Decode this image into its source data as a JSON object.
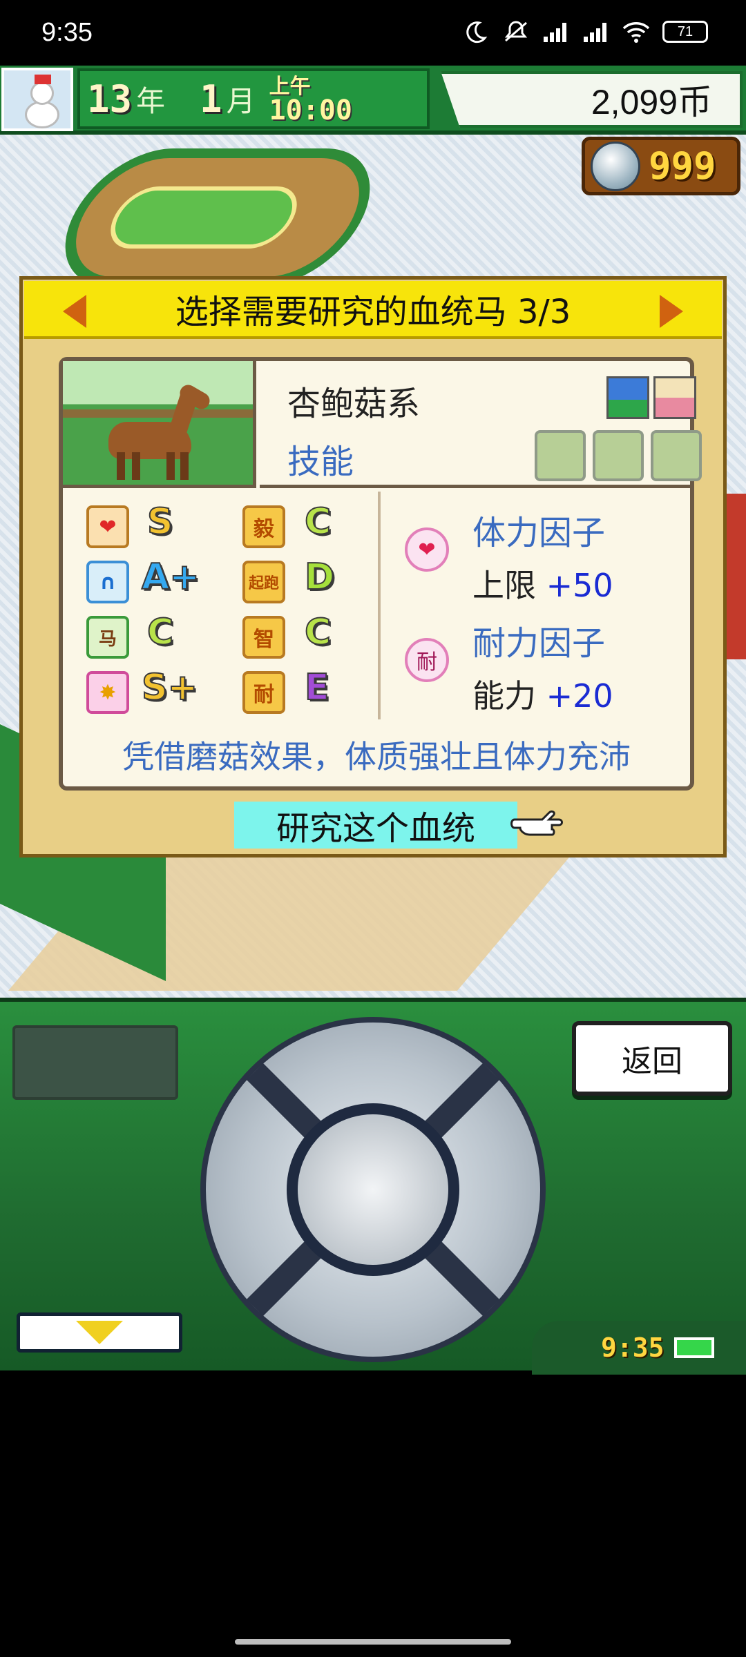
{
  "status_bar": {
    "time": "9:35",
    "battery": "71"
  },
  "hud": {
    "year_value": "13",
    "year_label": "年",
    "month_value": "1",
    "month_label": "月",
    "ampm": "上午",
    "time": "10:00",
    "money": "2,099币",
    "medals": "999"
  },
  "dialog": {
    "title": "选择需要研究的血统马 3/3",
    "lineage_name": "杏鲍菇系",
    "skills_label": "技能",
    "stats": [
      {
        "icon": "❤",
        "grade": "S",
        "kanji": "毅",
        "kanji_grade": "C"
      },
      {
        "icon": "∩",
        "grade": "A+",
        "kanji": "起跑",
        "kanji_grade": "D"
      },
      {
        "icon": "马",
        "grade": "C",
        "kanji": "智",
        "kanji_grade": "C"
      },
      {
        "icon": "✸",
        "grade": "S+",
        "kanji": "耐",
        "kanji_grade": "E"
      }
    ],
    "factors": [
      {
        "icon": "❤",
        "name": "体力因子",
        "desc_label": "上限",
        "value": "+50"
      },
      {
        "icon": "耐",
        "name": "耐力因子",
        "desc_label": "能力",
        "value": "+20"
      }
    ],
    "description": "凭借磨菇效果，体质强壮且体力充沛",
    "research_button": "研究这个血统"
  },
  "controller": {
    "back_label": "返回",
    "clock": "9:35"
  },
  "colors": {
    "title_bar": "#f7e40b",
    "accent_blue": "#3a6bc0",
    "value_blue": "#1a2bd3",
    "button_cyan": "#7df4ec"
  }
}
